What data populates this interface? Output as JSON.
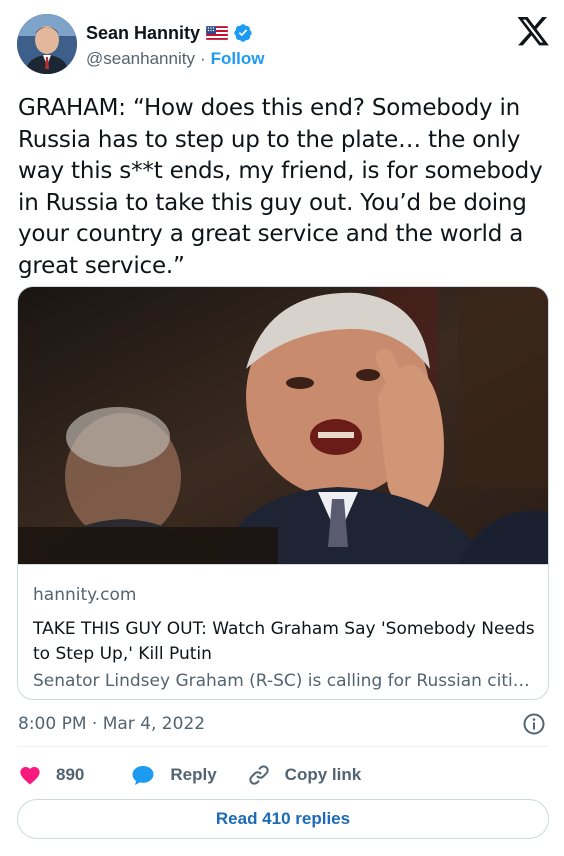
{
  "author": {
    "name": "Sean Hannity",
    "handle": "@seanhannity",
    "separator": "·",
    "follow_label": "Follow"
  },
  "tweet": {
    "text": "GRAHAM: “How does this end? Somebody in Russia has to step up to the plate… the only way this s**t ends, my friend, is for somebody in Russia to take this guy out. You’d be doing your country a great service and the world a great service.”",
    "timestamp": "8:00 PM · Mar 4, 2022"
  },
  "card": {
    "domain": "hannity.com",
    "title": "TAKE THIS GUY OUT: Watch Graham Say 'Somebody Needs to Step Up,' Kill Putin",
    "description": "Senator Lindsey Graham (R-SC) is calling for Russian citize..."
  },
  "actions": {
    "like_count": "890",
    "reply_label": "Reply",
    "copy_link_label": "Copy link"
  },
  "read_replies_label": "Read 410 replies",
  "colors": {
    "accent": "#1d9bf0",
    "like": "#f91880",
    "text": "#0f1419",
    "muted": "#536471",
    "border": "#cfd9de"
  },
  "icons": [
    "avatar",
    "us-flag-icon",
    "verified-badge-icon",
    "x-logo-icon",
    "info-icon",
    "heart-icon",
    "reply-icon",
    "link-icon"
  ]
}
